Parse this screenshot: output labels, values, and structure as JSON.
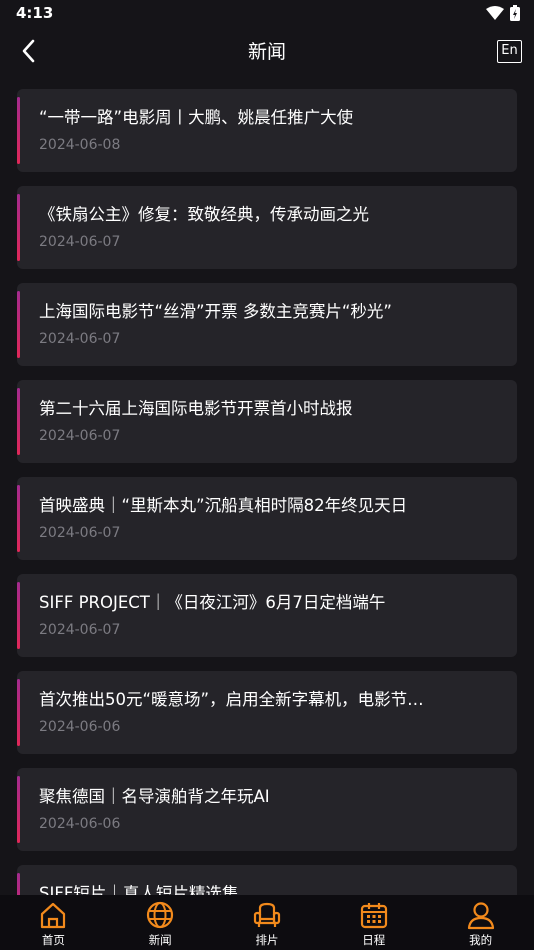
{
  "status": {
    "time": "4:13"
  },
  "nav": {
    "title": "新闻",
    "lang_label": "En"
  },
  "news": [
    {
      "title": "“一带一路”电影周丨大鹏、姚晨任推广大使",
      "date": "2024-06-08"
    },
    {
      "title": "《铁扇公主》修复：致敬经典，传承动画之光",
      "date": "2024-06-07"
    },
    {
      "title": "上海国际电影节“丝滑”开票 多数主竞赛片“秒光”",
      "date": "2024-06-07"
    },
    {
      "title": "第二十六届上海国际电影节开票首小时战报",
      "date": "2024-06-07"
    },
    {
      "title": "首映盛典｜“里斯本丸”沉船真相时隔82年终见天日",
      "date": "2024-06-07"
    },
    {
      "title": "SIFF PROJECT｜《日夜江河》6月7日定档端午",
      "date": "2024-06-07"
    },
    {
      "title": "首次推出50元“暖意场”，启用全新字幕机，电影节…",
      "date": "2024-06-06"
    },
    {
      "title": "聚焦德国｜名导演舶背之年玩AI",
      "date": "2024-06-06"
    },
    {
      "title": "SIFF短片｜真人短片精选集",
      "date": ""
    }
  ],
  "tabs": [
    {
      "label": "首页",
      "icon": "home-icon"
    },
    {
      "label": "新闻",
      "icon": "globe-icon"
    },
    {
      "label": "排片",
      "icon": "seat-icon"
    },
    {
      "label": "日程",
      "icon": "calendar-icon"
    },
    {
      "label": "我的",
      "icon": "person-icon"
    }
  ],
  "colors": {
    "accent_orange": "#f28a1c",
    "accent_bar_top": "#a42b8f",
    "accent_bar_bottom": "#e12858",
    "card_bg": "#252429",
    "page_bg": "#151418"
  }
}
